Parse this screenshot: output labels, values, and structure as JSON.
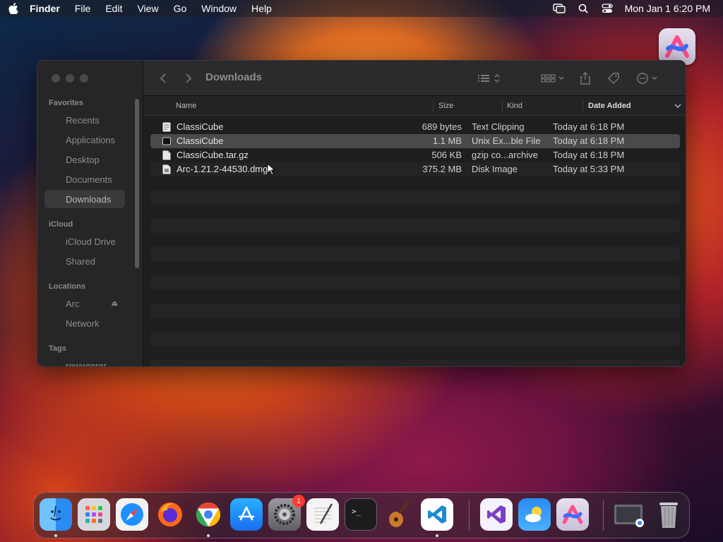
{
  "menubar": {
    "app": "Finder",
    "items": [
      "File",
      "Edit",
      "View",
      "Go",
      "Window",
      "Help"
    ],
    "clock": "Mon Jan 1  6:20 PM"
  },
  "window": {
    "title": "Downloads",
    "sidebar": {
      "favorites_header": "Favorites",
      "favorites": [
        "Recents",
        "Applications",
        "Desktop",
        "Documents",
        "Downloads"
      ],
      "icloud_header": "iCloud",
      "icloud": [
        "iCloud Drive",
        "Shared"
      ],
      "locations_header": "Locations",
      "locations": [
        "Arc",
        "Network"
      ],
      "tags_header": "Tags",
      "tags": [
        "rewwrerer"
      ],
      "eject_icon": "eject-icon"
    },
    "columns": {
      "name": "Name",
      "size": "Size",
      "kind": "Kind",
      "date": "Date Added"
    },
    "files": [
      {
        "name": "ClassiCube",
        "size": "689 bytes",
        "kind": "Text Clipping",
        "date": "Today at 6:18 PM"
      },
      {
        "name": "ClassiCube",
        "size": "1.1 MB",
        "kind": "Unix Ex...ble File",
        "date": "Today at 6:18 PM"
      },
      {
        "name": "ClassiCube.tar.gz",
        "size": "506 KB",
        "kind": "gzip co...archive",
        "date": "Today at 6:18 PM"
      },
      {
        "name": "Arc-1.21.2-44530.dmg",
        "size": "375.2 MB",
        "kind": "Disk Image",
        "date": "Today at 5:33 PM"
      }
    ]
  },
  "dock": {
    "settings_badge": "1",
    "apps": [
      "Finder",
      "Launchpad",
      "Safari",
      "Firefox",
      "Chrome",
      "App Store",
      "System Settings",
      "TextEdit",
      "Terminal",
      "GarageBand",
      "VS Code",
      "Visual Studio",
      "Weather",
      "Arc",
      "Downloads Stack",
      "Trash"
    ]
  },
  "colors": {
    "window_bg": "#1e1e1e",
    "sidebar_bg": "#262628",
    "selected_row": "#4a4a4c",
    "badge": "#ff3b30"
  }
}
